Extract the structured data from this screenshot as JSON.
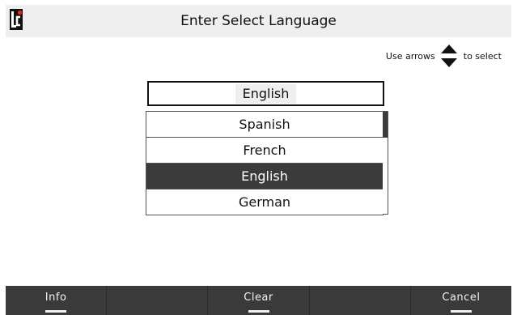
{
  "header": {
    "title": "Enter Select Language",
    "logo_icon": "lc-logo-icon"
  },
  "hint": {
    "prefix": "Use arrows",
    "suffix": "to select",
    "icon": "up-down-arrows-icon"
  },
  "selected": {
    "value": "English"
  },
  "list": {
    "items": [
      {
        "label": "Spanish"
      },
      {
        "label": "French"
      },
      {
        "label": "English",
        "highlighted": true
      },
      {
        "label": "German"
      }
    ]
  },
  "footer": {
    "keys": [
      {
        "label": "Info",
        "underline": true
      },
      {
        "label": ""
      },
      {
        "label": "Clear",
        "underline": true
      },
      {
        "label": ""
      },
      {
        "label": "Cancel",
        "underline": true
      }
    ]
  },
  "colors": {
    "header_bg": "#efefef",
    "highlight_bg": "#3b3b3b",
    "footer_bg": "#3a3a3a",
    "logo_red": "#e8232a"
  }
}
